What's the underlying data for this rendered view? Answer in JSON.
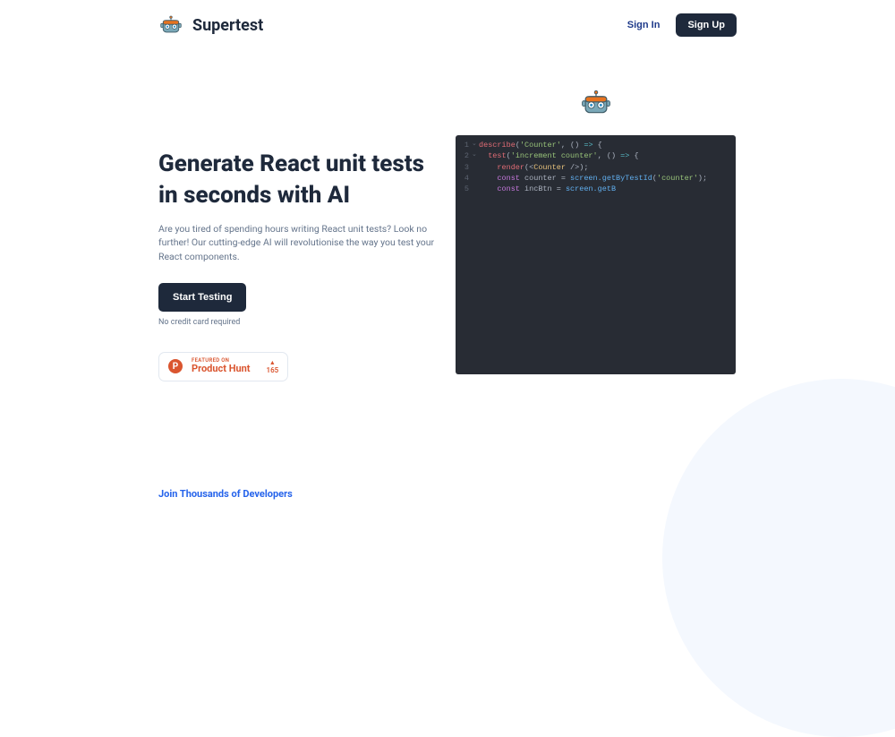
{
  "header": {
    "brand": "Supertest",
    "signin": "Sign In",
    "signup": "Sign Up"
  },
  "hero": {
    "title": "Generate React unit tests in seconds with AI",
    "description": "Are you tired of spending hours writing React unit tests? Look no further! Our cutting-edge AI will revolutionise the way you test your React components.",
    "cta": "Start Testing",
    "note": "No credit card required"
  },
  "producthunt": {
    "sub": "FEATURED ON",
    "main": "Product Hunt",
    "p": "P",
    "tri": "▲",
    "votes": "165"
  },
  "code": {
    "lines": [
      {
        "n": "1",
        "fold": "⌄",
        "tokens": [
          {
            "t": "describe",
            "c": "k-func"
          },
          {
            "t": "(",
            "c": "k-punc"
          },
          {
            "t": "'Counter'",
            "c": "k-str"
          },
          {
            "t": ", () ",
            "c": "k-punc"
          },
          {
            "t": "=>",
            "c": "k-op"
          },
          {
            "t": " {",
            "c": "k-punc"
          }
        ],
        "indent": 0
      },
      {
        "n": "2",
        "fold": "⌄",
        "tokens": [
          {
            "t": "test",
            "c": "k-func"
          },
          {
            "t": "(",
            "c": "k-punc"
          },
          {
            "t": "'increment counter'",
            "c": "k-str"
          },
          {
            "t": ", () ",
            "c": "k-punc"
          },
          {
            "t": "=>",
            "c": "k-op"
          },
          {
            "t": " {",
            "c": "k-punc"
          }
        ],
        "indent": 1
      },
      {
        "n": "3",
        "fold": "",
        "tokens": [
          {
            "t": "render",
            "c": "k-func"
          },
          {
            "t": "(<",
            "c": "k-punc"
          },
          {
            "t": "Counter",
            "c": "k-comp"
          },
          {
            "t": " />);",
            "c": "k-punc"
          }
        ],
        "indent": 2
      },
      {
        "n": "4",
        "fold": "",
        "tokens": [
          {
            "t": "const ",
            "c": "k-kw"
          },
          {
            "t": "counter ",
            "c": "k-var"
          },
          {
            "t": "= ",
            "c": "k-punc"
          },
          {
            "t": "screen.getByTestId",
            "c": "k-method"
          },
          {
            "t": "(",
            "c": "k-punc"
          },
          {
            "t": "'counter'",
            "c": "k-str"
          },
          {
            "t": ");",
            "c": "k-punc"
          }
        ],
        "indent": 2
      },
      {
        "n": "5",
        "fold": "",
        "tokens": [
          {
            "t": "const ",
            "c": "k-kw"
          },
          {
            "t": "incBtn ",
            "c": "k-var"
          },
          {
            "t": "= ",
            "c": "k-punc"
          },
          {
            "t": "screen.getB",
            "c": "k-method"
          }
        ],
        "indent": 2
      }
    ]
  },
  "footer": {
    "tagline": "Join Thousands of Developers"
  }
}
